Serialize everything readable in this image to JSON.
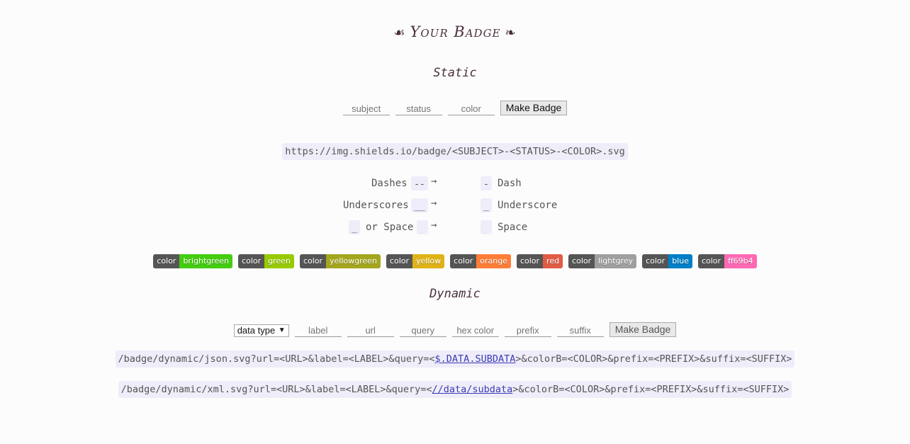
{
  "header": {
    "title": "Your Badge",
    "ornament_left": "☙",
    "ornament_right": "❧"
  },
  "static": {
    "heading": "Static",
    "subject_placeholder": "subject",
    "status_placeholder": "status",
    "color_placeholder": "color",
    "make_badge_label": "Make Badge",
    "url_template": "https://img.shields.io/badge/<SUBJECT>-<STATUS>-<COLOR>.svg",
    "conversions": [
      {
        "label": "Dashes",
        "from": "--",
        "arrow": "→",
        "to": "-",
        "result": "Dash"
      },
      {
        "label": "Underscores",
        "from": "__",
        "arrow": "→",
        "to": "_",
        "result": "Underscore"
      },
      {
        "from_pre": "_",
        "label": "or Space",
        "from": " ",
        "arrow": "→",
        "to": " ",
        "result": "Space"
      }
    ]
  },
  "badges": [
    {
      "left": "color",
      "right": "brightgreen",
      "color": "#4c1"
    },
    {
      "left": "color",
      "right": "green",
      "color": "#97ca00"
    },
    {
      "left": "color",
      "right": "yellowgreen",
      "color": "#a4a61d"
    },
    {
      "left": "color",
      "right": "yellow",
      "color": "#dfb317"
    },
    {
      "left": "color",
      "right": "orange",
      "color": "#fe7d37"
    },
    {
      "left": "color",
      "right": "red",
      "color": "#e05d44"
    },
    {
      "left": "color",
      "right": "lightgrey",
      "color": "#9f9f9f"
    },
    {
      "left": "color",
      "right": "blue",
      "color": "#007ec6"
    },
    {
      "left": "color",
      "right": "ff69b4",
      "color": "#ff69b4"
    }
  ],
  "dynamic": {
    "heading": "Dynamic",
    "data_type_value": "data type",
    "label_placeholder": "label",
    "url_placeholder": "url",
    "query_placeholder": "query",
    "hex_color_placeholder": "hex color",
    "prefix_placeholder": "prefix",
    "suffix_placeholder": "suffix",
    "make_badge_label": "Make Badge",
    "json_prefix": "/badge/dynamic/json.svg?url=<URL>&label=<LABEL>&query=<",
    "json_link": "$.DATA.SUBDATA",
    "json_suffix": ">&colorB=<COLOR>&prefix=<PREFIX>&suffix=<SUFFIX>",
    "xml_prefix": "/badge/dynamic/xml.svg?url=<URL>&label=<LABEL>&query=<",
    "xml_link": "//data/subdata",
    "xml_suffix": ">&colorB=<COLOR>&prefix=<PREFIX>&suffix=<SUFFIX>"
  }
}
